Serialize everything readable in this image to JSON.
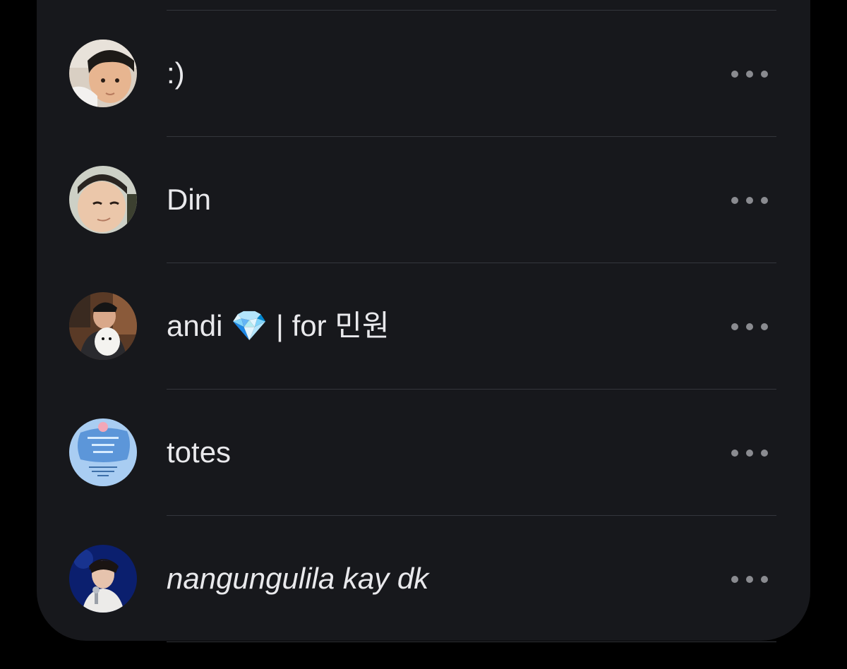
{
  "accounts": [
    {
      "name": ":)",
      "avatar": "toddler-photo-avatar",
      "menu": "more-options-icon"
    },
    {
      "name": "Din",
      "avatar": "child-photo-avatar",
      "menu": "more-options-icon"
    },
    {
      "name_prefix": "andi",
      "emoji": "💎",
      "name_suffix": "| for 민원",
      "avatar": "man-with-dog-avatar",
      "menu": "more-options-icon"
    },
    {
      "name": "totes",
      "avatar": "thank-you-card-avatar",
      "menu": "more-options-icon"
    },
    {
      "name": "nangungulila kay dk",
      "avatar": "singer-photo-avatar",
      "menu": "more-options-icon"
    }
  ],
  "colors": {
    "background": "#000000",
    "panel": "#17181c",
    "divider": "#34363c",
    "text": "#e9e9ec",
    "dots": "#8a8b90"
  }
}
